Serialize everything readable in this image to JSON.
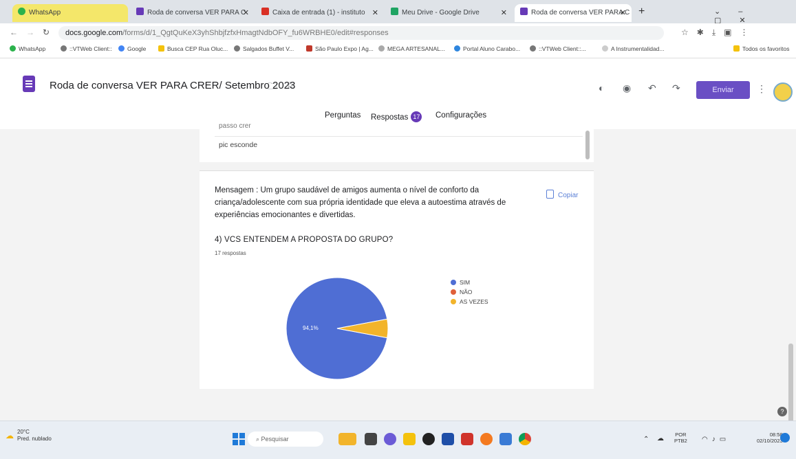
{
  "browser": {
    "tabs": [
      {
        "label": "WhatsApp",
        "active": false
      },
      {
        "label": "Roda de conversa VER PARA C",
        "active": false
      },
      {
        "label": "Caixa de entrada (1) - instituto",
        "active": false
      },
      {
        "label": "Meu Drive - Google Drive",
        "active": false
      },
      {
        "label": "Roda de conversa VER PARA C",
        "active": true
      }
    ],
    "new_tab": "+",
    "url_host": "docs.google.com",
    "url_path": "/forms/d/1_QgtQuKeX3yhShbjfzfxHmagtNdbOFY_fu6WRBHE0/edit#responses",
    "bookmarks": [
      "WhatsApp",
      "::VTWeb Client::",
      "Google",
      "Busca CEP Rua Oluc...",
      "Salgados Buffet V...",
      "São Paulo Expo | Ag...",
      "MEGA ARTESANAL...",
      "Portal Aluno Carabo...",
      "::VTWeb Client::...",
      "A Instrumentalidad...",
      "Todos os favoritos"
    ]
  },
  "form": {
    "title": "Roda de conversa VER PARA CRER/ Setembro 2023",
    "send_label": "Enviar",
    "tabs": {
      "questions": "Perguntas",
      "responses": "Respostas",
      "responses_count": "17",
      "settings": "Configurações"
    },
    "prev_response_partial": "passo crer",
    "prev_response_last": "pic esconde",
    "message": "Mensagem : Um grupo saudável de amigos aumenta o nível de conforto da criança/adolescente com sua própria identidade que eleva a autoestima através de experiências emocionantes e divertidas.",
    "copy_label": "Copiar",
    "question": "4) VCS ENTENDEM A PROPOSTA DO GRUPO?",
    "response_count_label": "17 respostas"
  },
  "chart_data": {
    "type": "pie",
    "labels": [
      "SIM",
      "NÃO",
      "AS VEZES"
    ],
    "values": [
      94.1,
      0,
      5.9
    ],
    "colors": [
      "#4f6ed4",
      "#e0603a",
      "#f2b42b"
    ],
    "data_labels": [
      "94,1%",
      "",
      ""
    ],
    "legend_position": "right"
  },
  "taskbar": {
    "temperature": "20°C",
    "weather_text": "Pred. nublado",
    "search_placeholder": "Pesquisar",
    "lang_top": "POR",
    "lang_bottom": "PTB2",
    "time": "08:58",
    "date": "02/10/2023"
  }
}
